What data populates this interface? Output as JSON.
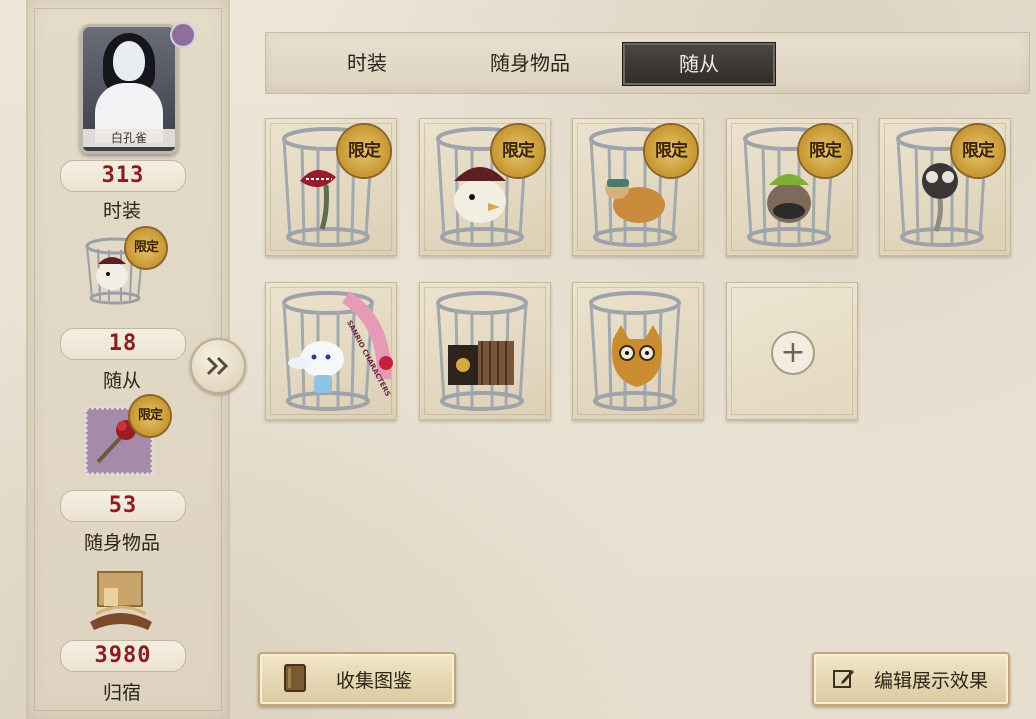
{
  "sidebar": {
    "character_name": "白孔雀",
    "stats": [
      {
        "value": "313",
        "label": "时装"
      },
      {
        "value": "18",
        "label": "随从"
      },
      {
        "value": "53",
        "label": "随身物品"
      },
      {
        "value": "3980",
        "label": "归宿"
      }
    ],
    "badges": {
      "follower": "限定",
      "item": "限定"
    }
  },
  "tabs": [
    {
      "label": "时装",
      "active": false
    },
    {
      "label": "随身物品",
      "active": false
    },
    {
      "label": "随从",
      "active": true
    }
  ],
  "grid": {
    "items": [
      {
        "name": "man-eating-plant",
        "badge": "限定"
      },
      {
        "name": "pirate-bird",
        "badge": "限定"
      },
      {
        "name": "goggles-squirrel",
        "badge": "限定"
      },
      {
        "name": "green-hat-mouse",
        "badge": "限定"
      },
      {
        "name": "dark-flower-creature",
        "badge": "限定"
      },
      {
        "name": "cinnamoroll",
        "badge": "",
        "ribbon": "SANRIO CHARACTERS"
      },
      {
        "name": "accordion-box",
        "badge": ""
      },
      {
        "name": "orange-cat",
        "badge": ""
      },
      {
        "name": "add-slot",
        "badge": "",
        "plus": "+"
      }
    ]
  },
  "buttons": {
    "collection": "收集图鉴",
    "edit_display": "编辑展示效果"
  },
  "colors": {
    "stat_number": "#8a1e1e",
    "active_tab_bg": "#3a3733",
    "limited_badge": "#c99a35"
  }
}
